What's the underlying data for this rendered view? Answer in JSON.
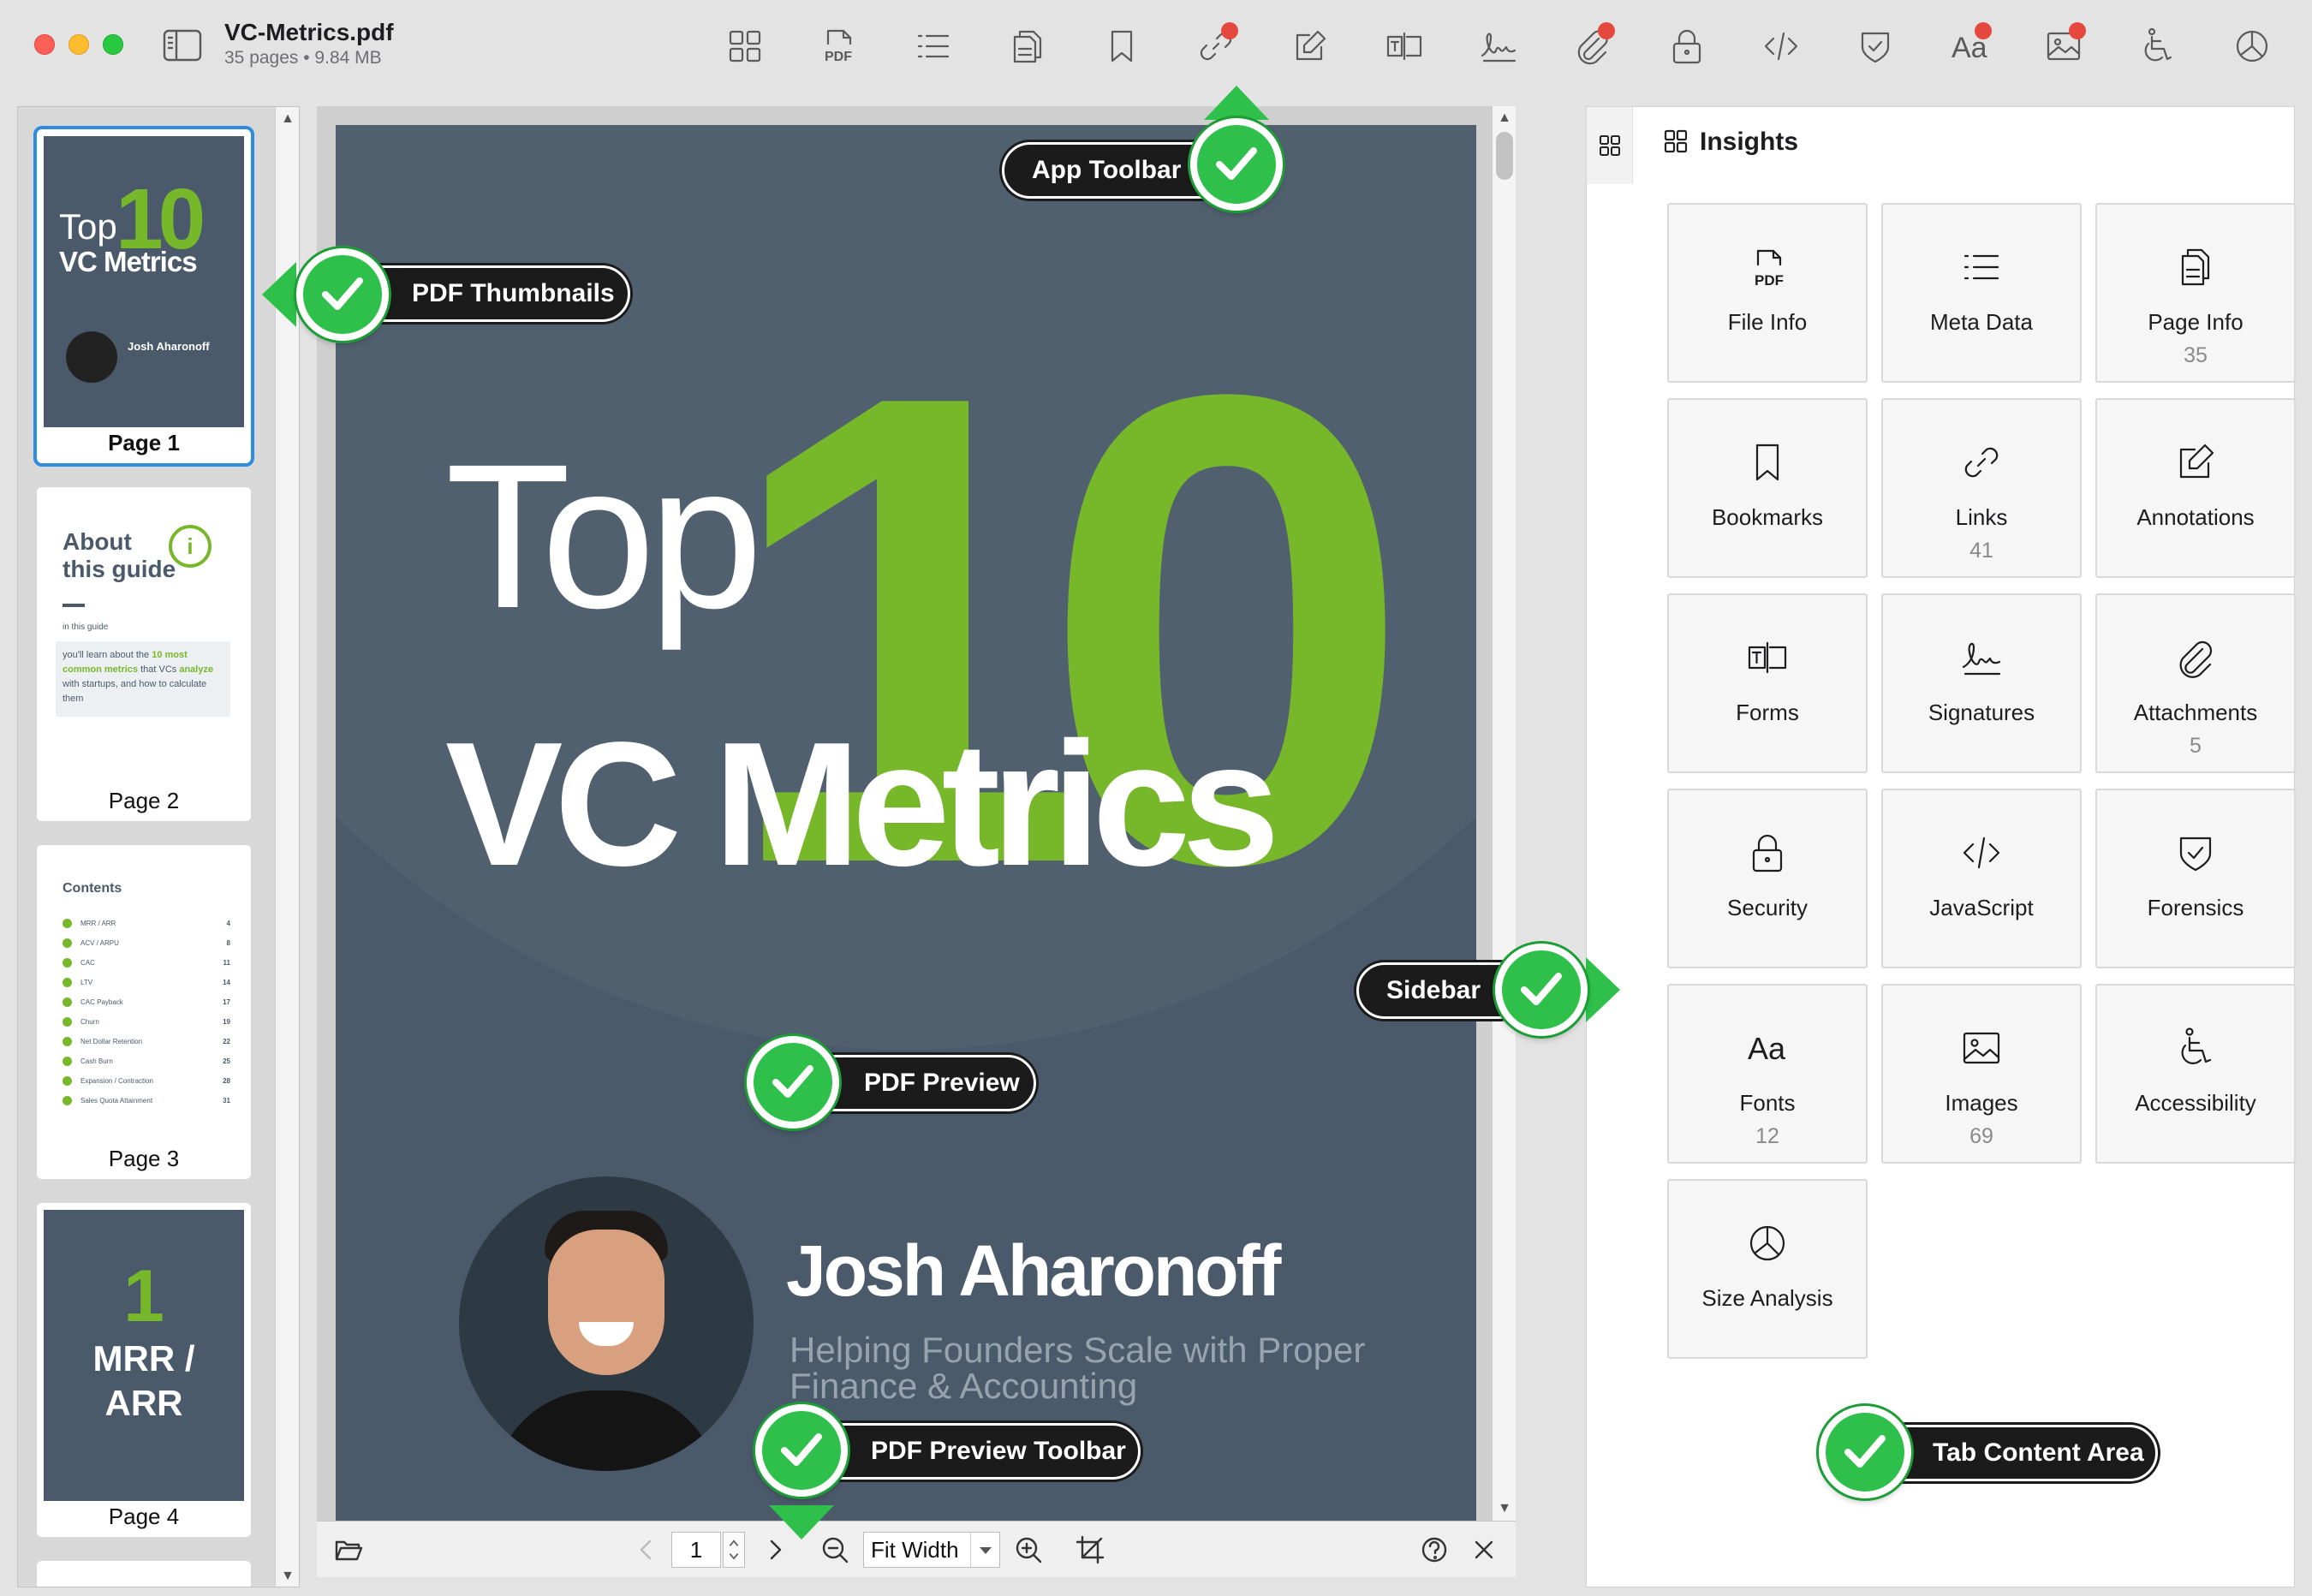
{
  "window": {
    "title": "VC-Metrics.pdf",
    "subtitle": "35 pages • 9.84 MB"
  },
  "toolbar": {
    "icons": [
      "thumbnails-grid-icon",
      "pdf-file-icon",
      "list-icon",
      "page-info-icon",
      "bookmark-icon",
      "link-icon",
      "annotation-icon",
      "form-field-icon",
      "signature-icon",
      "attachment-icon",
      "lock-icon",
      "code-icon",
      "shield-icon",
      "fonts-icon",
      "image-icon",
      "accessibility-icon",
      "pie-chart-icon"
    ],
    "pdf_icon_text": "PDF",
    "fonts_icon_text": "Aa",
    "badge_color": "#e5483c"
  },
  "thumbnails": [
    {
      "label": "Page 1",
      "selected": true
    },
    {
      "label": "Page 2",
      "selected": false
    },
    {
      "label": "Page 3",
      "selected": false
    },
    {
      "label": "Page 4",
      "selected": false
    }
  ],
  "thumb_content": {
    "p1_top": "Top",
    "p1_ten": "10",
    "p1_vc": "VC Metrics",
    "p1_author": "Josh Aharonoff",
    "p2_title_a": "About",
    "p2_title_b": "this guide",
    "p2_sub": "in this guide",
    "p2_body_a": "you'll learn about the",
    "p2_body_b": "10 most",
    "p2_body_c": "common metrics",
    "p2_body_d": "that VCs",
    "p2_body_e": "analyze",
    "p2_body_f": "with startups, and how",
    "p2_body_g": "to calculate them",
    "p3_title": "Contents",
    "p3_items": [
      {
        "name": "MRR / ARR",
        "page": "4"
      },
      {
        "name": "ACV / ARPU",
        "page": "8"
      },
      {
        "name": "CAC",
        "page": "11"
      },
      {
        "name": "LTV",
        "page": "14"
      },
      {
        "name": "CAC Payback",
        "page": "17"
      },
      {
        "name": "Churn",
        "page": "19"
      },
      {
        "name": "Net Dollar Retention",
        "page": "22"
      },
      {
        "name": "Cash Burn",
        "page": "25"
      },
      {
        "name": "Expansion / Contraction",
        "page": "28"
      },
      {
        "name": "Sales Quota Attainment",
        "page": "31"
      }
    ],
    "p4_number": "1",
    "p4_title_a": "MRR /",
    "p4_title_b": "ARR"
  },
  "pdf_page": {
    "top": "Top",
    "ten": "10",
    "vc_metrics": "VC Metrics",
    "author": "Josh Aharonoff",
    "tagline_a": "Helping Founders Scale with Proper",
    "tagline_b": "Finance & Accounting",
    "background": "#4a5a6a",
    "accent": "#76b82a"
  },
  "preview_toolbar": {
    "page_value": "1",
    "zoom_value": "Fit Width"
  },
  "insights": {
    "title": "Insights",
    "tiles": [
      {
        "icon": "pdf-file-icon",
        "label": "File Info",
        "count": ""
      },
      {
        "icon": "list-icon",
        "label": "Meta Data",
        "count": ""
      },
      {
        "icon": "page-info-icon",
        "label": "Page Info",
        "count": "35"
      },
      {
        "icon": "bookmark-icon",
        "label": "Bookmarks",
        "count": ""
      },
      {
        "icon": "link-icon",
        "label": "Links",
        "count": "41"
      },
      {
        "icon": "annotation-icon",
        "label": "Annotations",
        "count": ""
      },
      {
        "icon": "form-field-icon",
        "label": "Forms",
        "count": ""
      },
      {
        "icon": "signature-icon",
        "label": "Signatures",
        "count": ""
      },
      {
        "icon": "attachment-icon",
        "label": "Attachments",
        "count": "5"
      },
      {
        "icon": "lock-icon",
        "label": "Security",
        "count": ""
      },
      {
        "icon": "code-icon",
        "label": "JavaScript",
        "count": ""
      },
      {
        "icon": "shield-icon",
        "label": "Forensics",
        "count": ""
      },
      {
        "icon": "fonts-icon",
        "label": "Fonts",
        "count": "12"
      },
      {
        "icon": "image-icon",
        "label": "Images",
        "count": "69"
      },
      {
        "icon": "accessibility-icon",
        "label": "Accessibility",
        "count": ""
      },
      {
        "icon": "pie-chart-icon",
        "label": "Size Analysis",
        "count": ""
      }
    ]
  },
  "callouts": {
    "app_toolbar": "App Toolbar",
    "pdf_thumbnails": "PDF Thumbnails",
    "sidebar": "Sidebar",
    "pdf_preview": "PDF Preview",
    "pdf_preview_toolbar": "PDF Preview Toolbar",
    "tab_content_area": "Tab Content Area",
    "check_color": "#2ec04a"
  }
}
